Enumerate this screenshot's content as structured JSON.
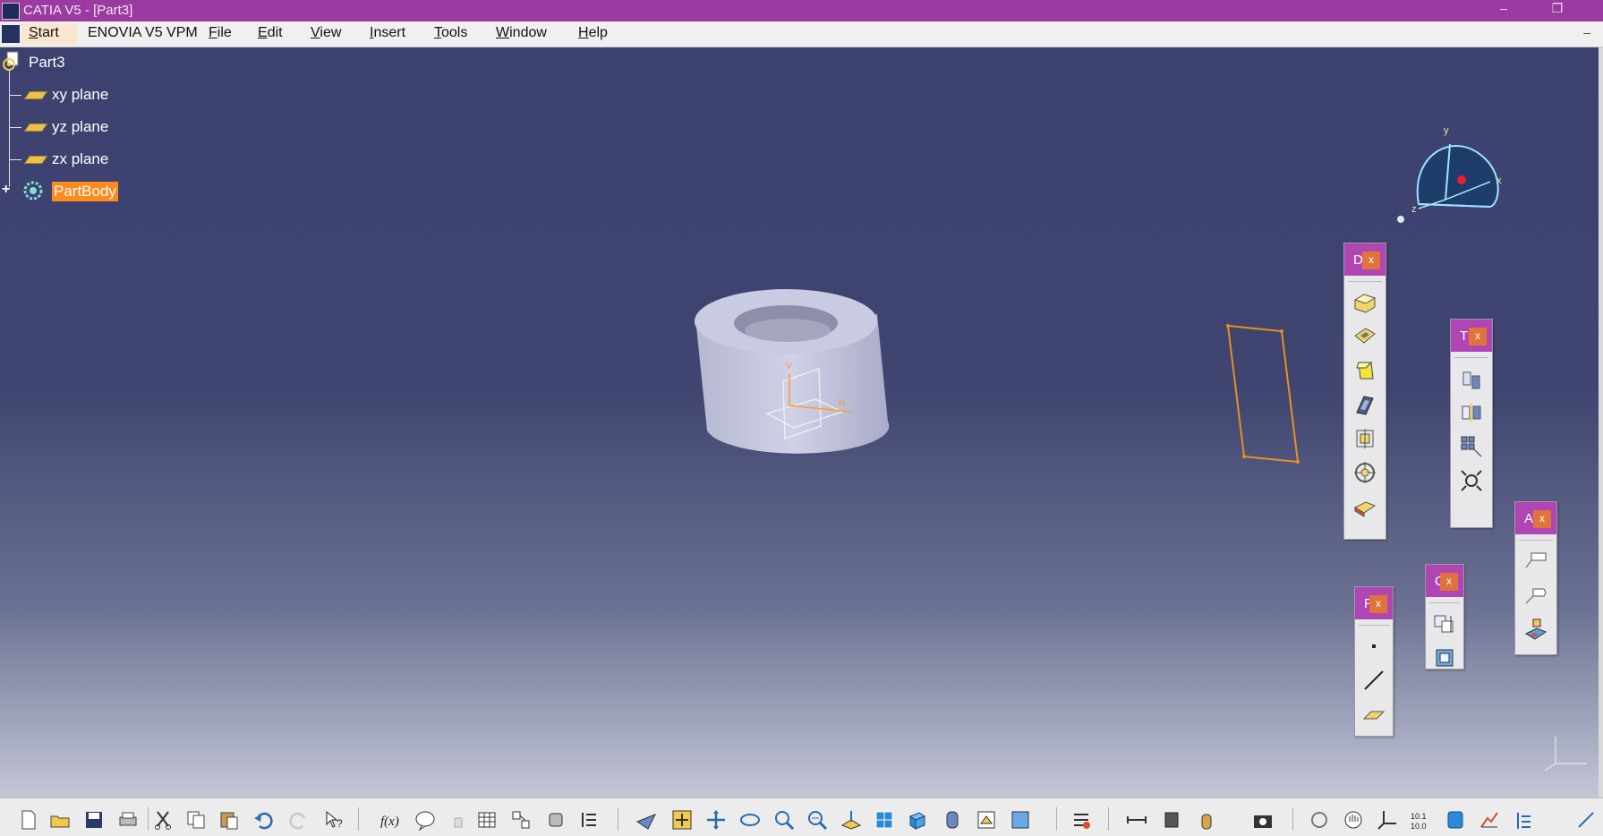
{
  "window": {
    "title": "CATIA V5 - [Part3]"
  },
  "menu": {
    "items": [
      "Start",
      "ENOVIA V5 VPM",
      "File",
      "Edit",
      "View",
      "Insert",
      "Tools",
      "Window",
      "Help"
    ]
  },
  "tree": {
    "root": "Part3",
    "nodes": [
      "xy plane",
      "yz plane",
      "zx plane"
    ],
    "body": "PartBody"
  },
  "toolbars": {
    "d": {
      "letter": "D"
    },
    "t": {
      "letter": "T"
    },
    "a": {
      "letter": "A"
    },
    "c": {
      "letter": "C"
    },
    "f": {
      "letter": "F"
    },
    "close_label": "x"
  },
  "compass": {
    "x_label": "x",
    "y_label": "y",
    "z_label": "z"
  },
  "part_axis": {
    "v_label": "V",
    "h_label": "H"
  },
  "colors": {
    "title_bar": "#9b3aa0",
    "selection": "#ff8a1e",
    "background_top": "#3d4170",
    "background_bottom": "#c4c7d7",
    "sketch_orange": "#e8901f"
  }
}
